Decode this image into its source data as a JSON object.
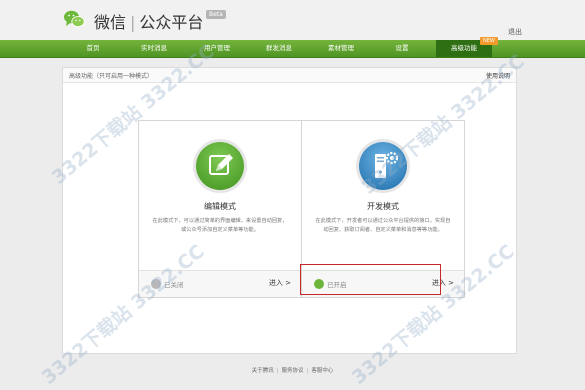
{
  "header": {
    "brand": "微信",
    "product": "公众平台",
    "beta": "Beta",
    "logout": "退出"
  },
  "nav": {
    "items": [
      "首页",
      "实时消息",
      "用户管理",
      "群发消息",
      "素材管理",
      "设置",
      "高级功能"
    ],
    "active_index": 6,
    "new_badge": "NEW"
  },
  "subbar": {
    "breadcrumb": "高级功能（只可启用一种模式）",
    "help": "使用说明"
  },
  "cards": [
    {
      "title": "编辑模式",
      "desc": "在此模式下，可以通过简单的界面编辑，来设置自动回复，或公众号添加自定义菜单等功能。",
      "status": "已关闭",
      "enter": "进入 >",
      "icon": "edit-pencil-icon",
      "icon_color": "#5cb135",
      "status_color": "#b9b9b9"
    },
    {
      "title": "开发模式",
      "desc": "在此模式下，开发者可以通过公众平台提供的接口，实现自动回复、获取订阅者、自定义菜单和消息等等功能。",
      "status": "已开启",
      "enter": "进入 >",
      "icon": "server-gear-icon",
      "icon_color": "#3f8fc7",
      "status_color": "#6cb53c"
    }
  ],
  "footer": {
    "links": [
      "关于腾讯",
      "服务协议",
      "客服中心"
    ]
  },
  "watermark": "3322下载站 3322.CC"
}
